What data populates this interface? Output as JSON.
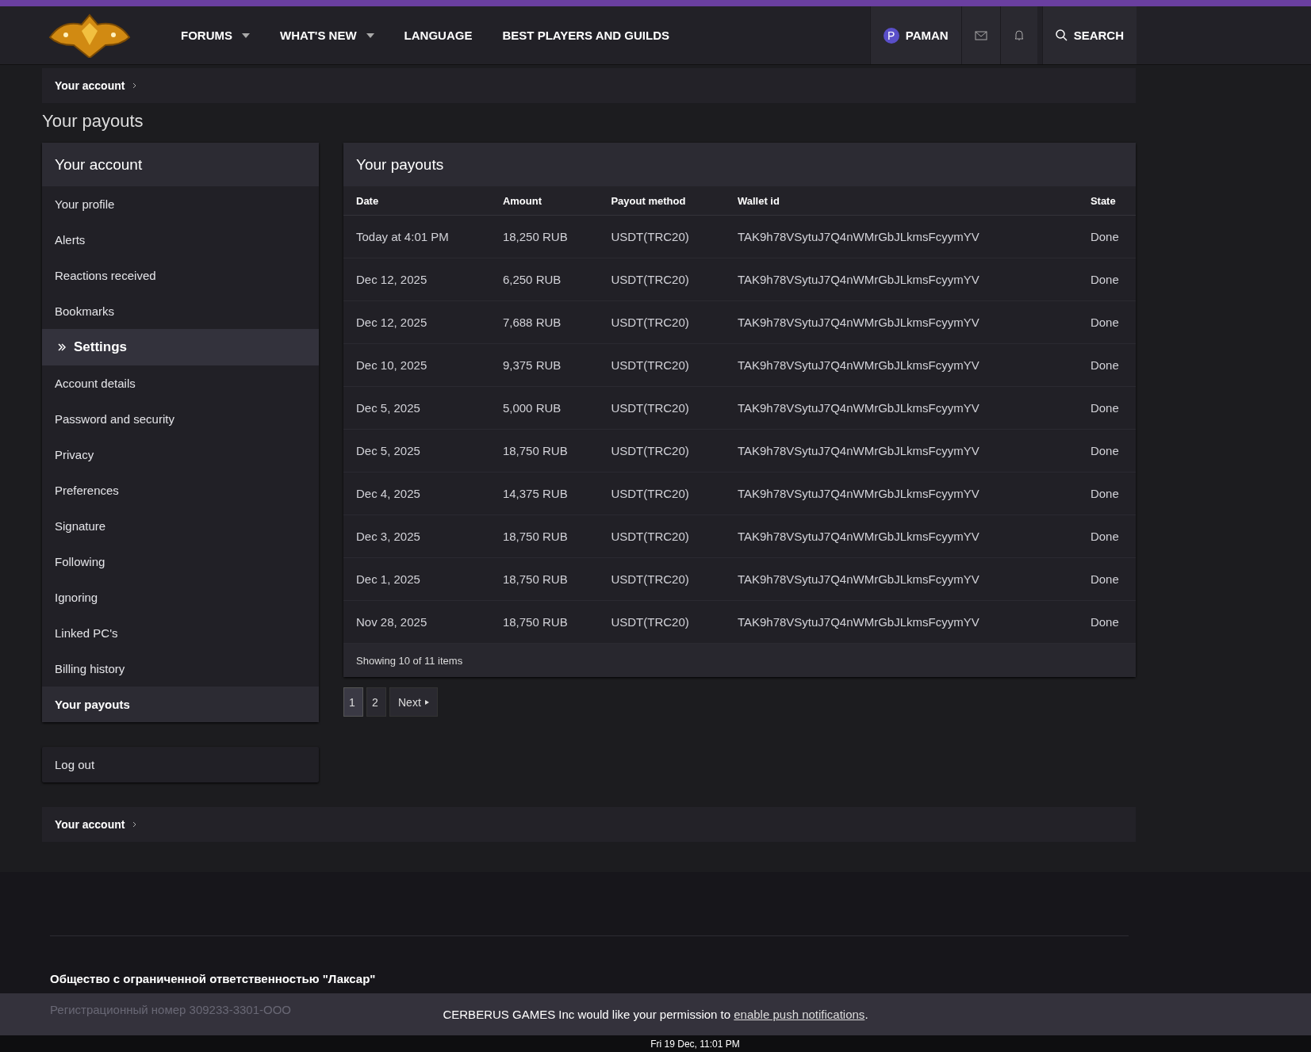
{
  "nav": {
    "items": [
      {
        "label": "FORUMS",
        "dropdown": true
      },
      {
        "label": "WHAT'S NEW",
        "dropdown": true
      },
      {
        "label": "LANGUAGE",
        "dropdown": false
      },
      {
        "label": "BEST PLAYERS AND GUILDS",
        "dropdown": false
      }
    ],
    "user": {
      "initial": "P",
      "name": "PAMAN"
    },
    "search": "SEARCH"
  },
  "breadcrumb_top": "Your account",
  "page_title": "Your payouts",
  "sidebar": {
    "title": "Your account",
    "items": [
      {
        "label": "Your profile",
        "kind": "link",
        "selected": false
      },
      {
        "label": "Alerts",
        "kind": "link",
        "selected": false
      },
      {
        "label": "Reactions received",
        "kind": "link",
        "selected": false
      },
      {
        "label": "Bookmarks",
        "kind": "link",
        "selected": false
      },
      {
        "label": "Settings",
        "kind": "section",
        "selected": false
      },
      {
        "label": "Account details",
        "kind": "link",
        "selected": false
      },
      {
        "label": "Password and security",
        "kind": "link",
        "selected": false
      },
      {
        "label": "Privacy",
        "kind": "link",
        "selected": false
      },
      {
        "label": "Preferences",
        "kind": "link",
        "selected": false
      },
      {
        "label": "Signature",
        "kind": "link",
        "selected": false
      },
      {
        "label": "Following",
        "kind": "link",
        "selected": false
      },
      {
        "label": "Ignoring",
        "kind": "link",
        "selected": false
      },
      {
        "label": "Linked PC's",
        "kind": "link",
        "selected": false
      },
      {
        "label": "Billing history",
        "kind": "link",
        "selected": false
      },
      {
        "label": "Your payouts",
        "kind": "link",
        "selected": true
      }
    ],
    "logout": "Log out"
  },
  "table": {
    "title": "Your payouts",
    "columns": [
      "Date",
      "Amount",
      "Payout method",
      "Wallet id",
      "State"
    ],
    "rows": [
      [
        "Today at 4:01 PM",
        "18,250 RUB",
        "USDT(TRC20)",
        "TAK9h78VSytuJ7Q4nWMrGbJLkmsFcyymYV",
        "Done"
      ],
      [
        "Dec 12, 2025",
        "6,250 RUB",
        "USDT(TRC20)",
        "TAK9h78VSytuJ7Q4nWMrGbJLkmsFcyymYV",
        "Done"
      ],
      [
        "Dec 12, 2025",
        "7,688 RUB",
        "USDT(TRC20)",
        "TAK9h78VSytuJ7Q4nWMrGbJLkmsFcyymYV",
        "Done"
      ],
      [
        "Dec 10, 2025",
        "9,375 RUB",
        "USDT(TRC20)",
        "TAK9h78VSytuJ7Q4nWMrGbJLkmsFcyymYV",
        "Done"
      ],
      [
        "Dec 5, 2025",
        "5,000 RUB",
        "USDT(TRC20)",
        "TAK9h78VSytuJ7Q4nWMrGbJLkmsFcyymYV",
        "Done"
      ],
      [
        "Dec 5, 2025",
        "18,750 RUB",
        "USDT(TRC20)",
        "TAK9h78VSytuJ7Q4nWMrGbJLkmsFcyymYV",
        "Done"
      ],
      [
        "Dec 4, 2025",
        "14,375 RUB",
        "USDT(TRC20)",
        "TAK9h78VSytuJ7Q4nWMrGbJLkmsFcyymYV",
        "Done"
      ],
      [
        "Dec 3, 2025",
        "18,750 RUB",
        "USDT(TRC20)",
        "TAK9h78VSytuJ7Q4nWMrGbJLkmsFcyymYV",
        "Done"
      ],
      [
        "Dec 1, 2025",
        "18,750 RUB",
        "USDT(TRC20)",
        "TAK9h78VSytuJ7Q4nWMrGbJLkmsFcyymYV",
        "Done"
      ],
      [
        "Nov 28, 2025",
        "18,750 RUB",
        "USDT(TRC20)",
        "TAK9h78VSytuJ7Q4nWMrGbJLkmsFcyymYV",
        "Done"
      ]
    ],
    "footer": "Showing 10 of 11 items"
  },
  "pagination": {
    "pages": [
      {
        "label": "1",
        "selected": true
      },
      {
        "label": "2",
        "selected": false
      }
    ],
    "next": "Next"
  },
  "breadcrumb_bottom": "Your account",
  "footer": {
    "company": "Общество с ограниченной ответственностью \"Лаксар\"",
    "reg": "Регистрационный номер 309233-3301-ООО"
  },
  "notification": {
    "text": "CERBERUS GAMES Inc would like your permission to ",
    "link": "enable push notifications",
    "end": "."
  },
  "clock": "Fri 19 Dec, 11:01 PM"
}
